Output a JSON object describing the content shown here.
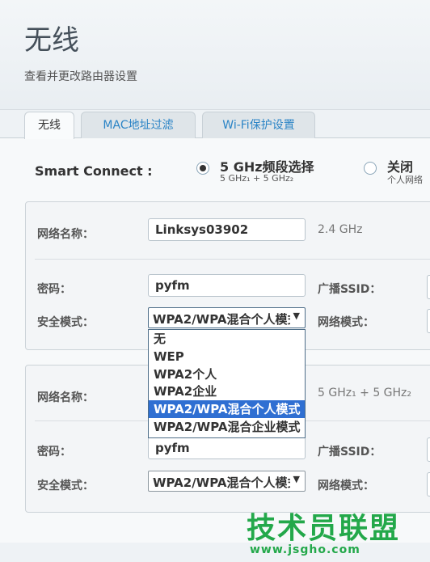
{
  "header": {
    "title": "无线",
    "subtitle": "查看并更改路由器设置"
  },
  "tabs": [
    {
      "label": "无线",
      "active": true
    },
    {
      "label": "MAC地址过滤",
      "active": false
    },
    {
      "label": "Wi-Fi保护设置",
      "active": false
    }
  ],
  "smart_connect": {
    "label": "Smart Connect :",
    "option_5ghz": {
      "title": "5 GHz频段选择",
      "subtitle": "5 GHz₁ + 5 GHz₂",
      "selected": true
    },
    "option_off": {
      "title": "关闭",
      "subtitle": "个人网络",
      "selected": false
    }
  },
  "panel1": {
    "network_name_label": "网络名称：",
    "network_name_value": "Linksys03902",
    "band": "2.4 GHz",
    "password_label": "密码：",
    "password_value": "pyfm",
    "broadcast_label": "广播SSID：",
    "security_label": "安全模式：",
    "security_value": "WPA2/WPA混合个人模式",
    "network_mode_label": "网络模式："
  },
  "dropdown": {
    "options": [
      "无",
      "WEP",
      "WPA2个人",
      "WPA2企业",
      "WPA2/WPA混合个人模式",
      "WPA2/WPA混合企业模式"
    ],
    "selected_index": 4
  },
  "panel2": {
    "network_name_label": "网络名称：",
    "band": "5 GHz₁ + 5 GHz₂",
    "password_label": "密码：",
    "password_value": "pyfm",
    "broadcast_label": "广播SSID：",
    "security_label": "安全模式：",
    "security_value": "WPA2/WPA混合个人模式",
    "network_mode_label": "网络模式："
  },
  "watermark": {
    "title": "技术员联盟",
    "url": "www.jsgho.com"
  },
  "colors": {
    "tab_link": "#2b84c6",
    "selected_option": "#2f6fd2",
    "watermark": "#23a84a"
  }
}
